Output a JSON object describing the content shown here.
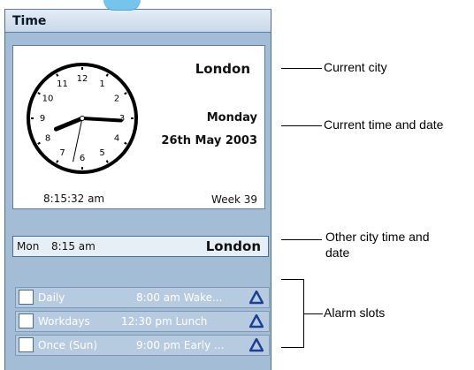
{
  "window": {
    "title": "Time"
  },
  "clock": {
    "numerals": [
      "12",
      "1",
      "2",
      "3",
      "4",
      "5",
      "6",
      "7",
      "8",
      "9",
      "10",
      "11"
    ],
    "digital_time": "8:15:32 am",
    "week": "Week 39",
    "hands": {
      "hour": 8,
      "minute": 15,
      "second": 32
    }
  },
  "current": {
    "city": "London",
    "day": "Monday",
    "date": "26th May 2003"
  },
  "other_city": {
    "day": "Mon",
    "time": "8:15 am",
    "city": "London"
  },
  "alarms": [
    {
      "label": "Daily",
      "time": "8:00 am Wake..."
    },
    {
      "label": "Workdays",
      "time": "12:30 pm Lunch"
    },
    {
      "label": "Once (Sun)",
      "time": "9:00 pm Early ..."
    }
  ],
  "callouts": {
    "current_city": "Current city",
    "current_time_date": "Current time and date",
    "other_city_line1": "Other city time and",
    "other_city_line2": "date",
    "alarm_slots": "Alarm slots"
  },
  "colors": {
    "panel": "#a4bdd6",
    "bell": "#1c3f95"
  }
}
